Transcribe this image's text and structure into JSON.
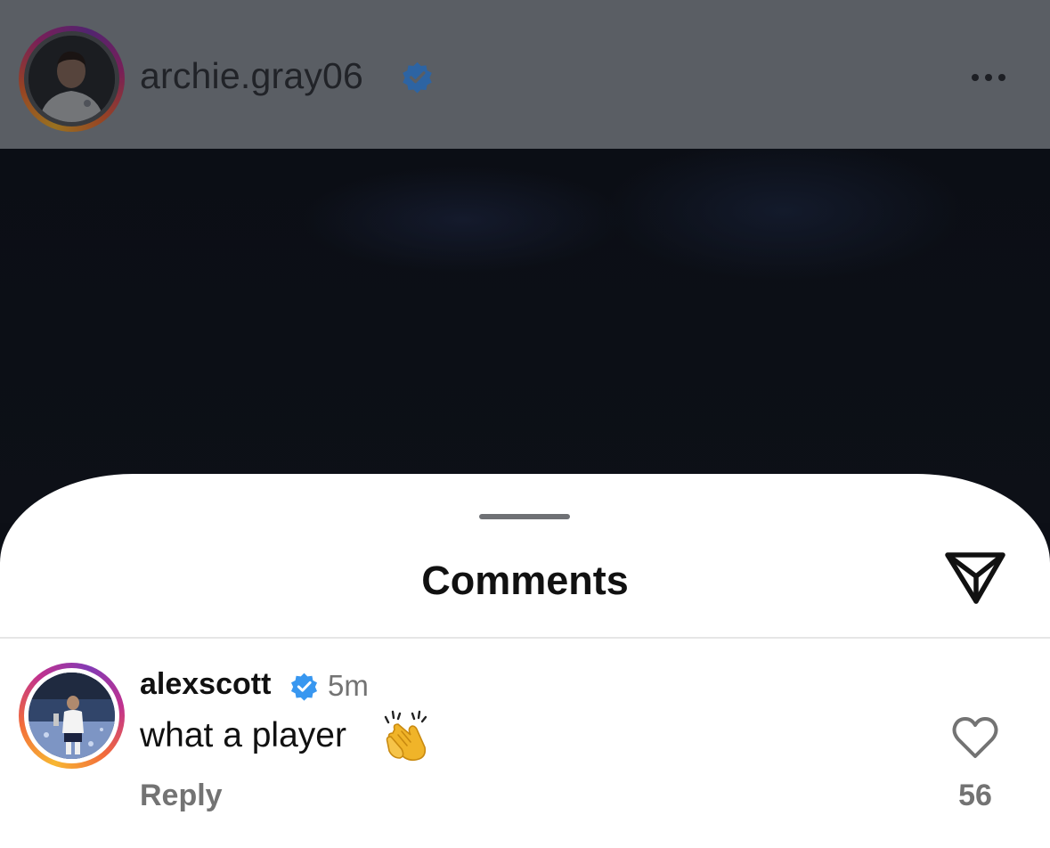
{
  "post": {
    "username": "archie.gray06",
    "verified": true,
    "avatar_icon": "profile-photo-player-england-kit",
    "more_icon": "ellipsis-icon"
  },
  "sheet": {
    "title": "Comments",
    "share_icon": "paper-plane-icon"
  },
  "comments": [
    {
      "username": "alexscott",
      "verified": true,
      "time": "5m",
      "text": "what a player",
      "emoji_icon": "clapping-hands-icon",
      "reply_label": "Reply",
      "likes": "56",
      "like_icon": "heart-outline-icon"
    }
  ],
  "colors": {
    "verified_blue": "#3897f0",
    "secondary_text": "#737373",
    "header_dim": "#5a5e64"
  }
}
